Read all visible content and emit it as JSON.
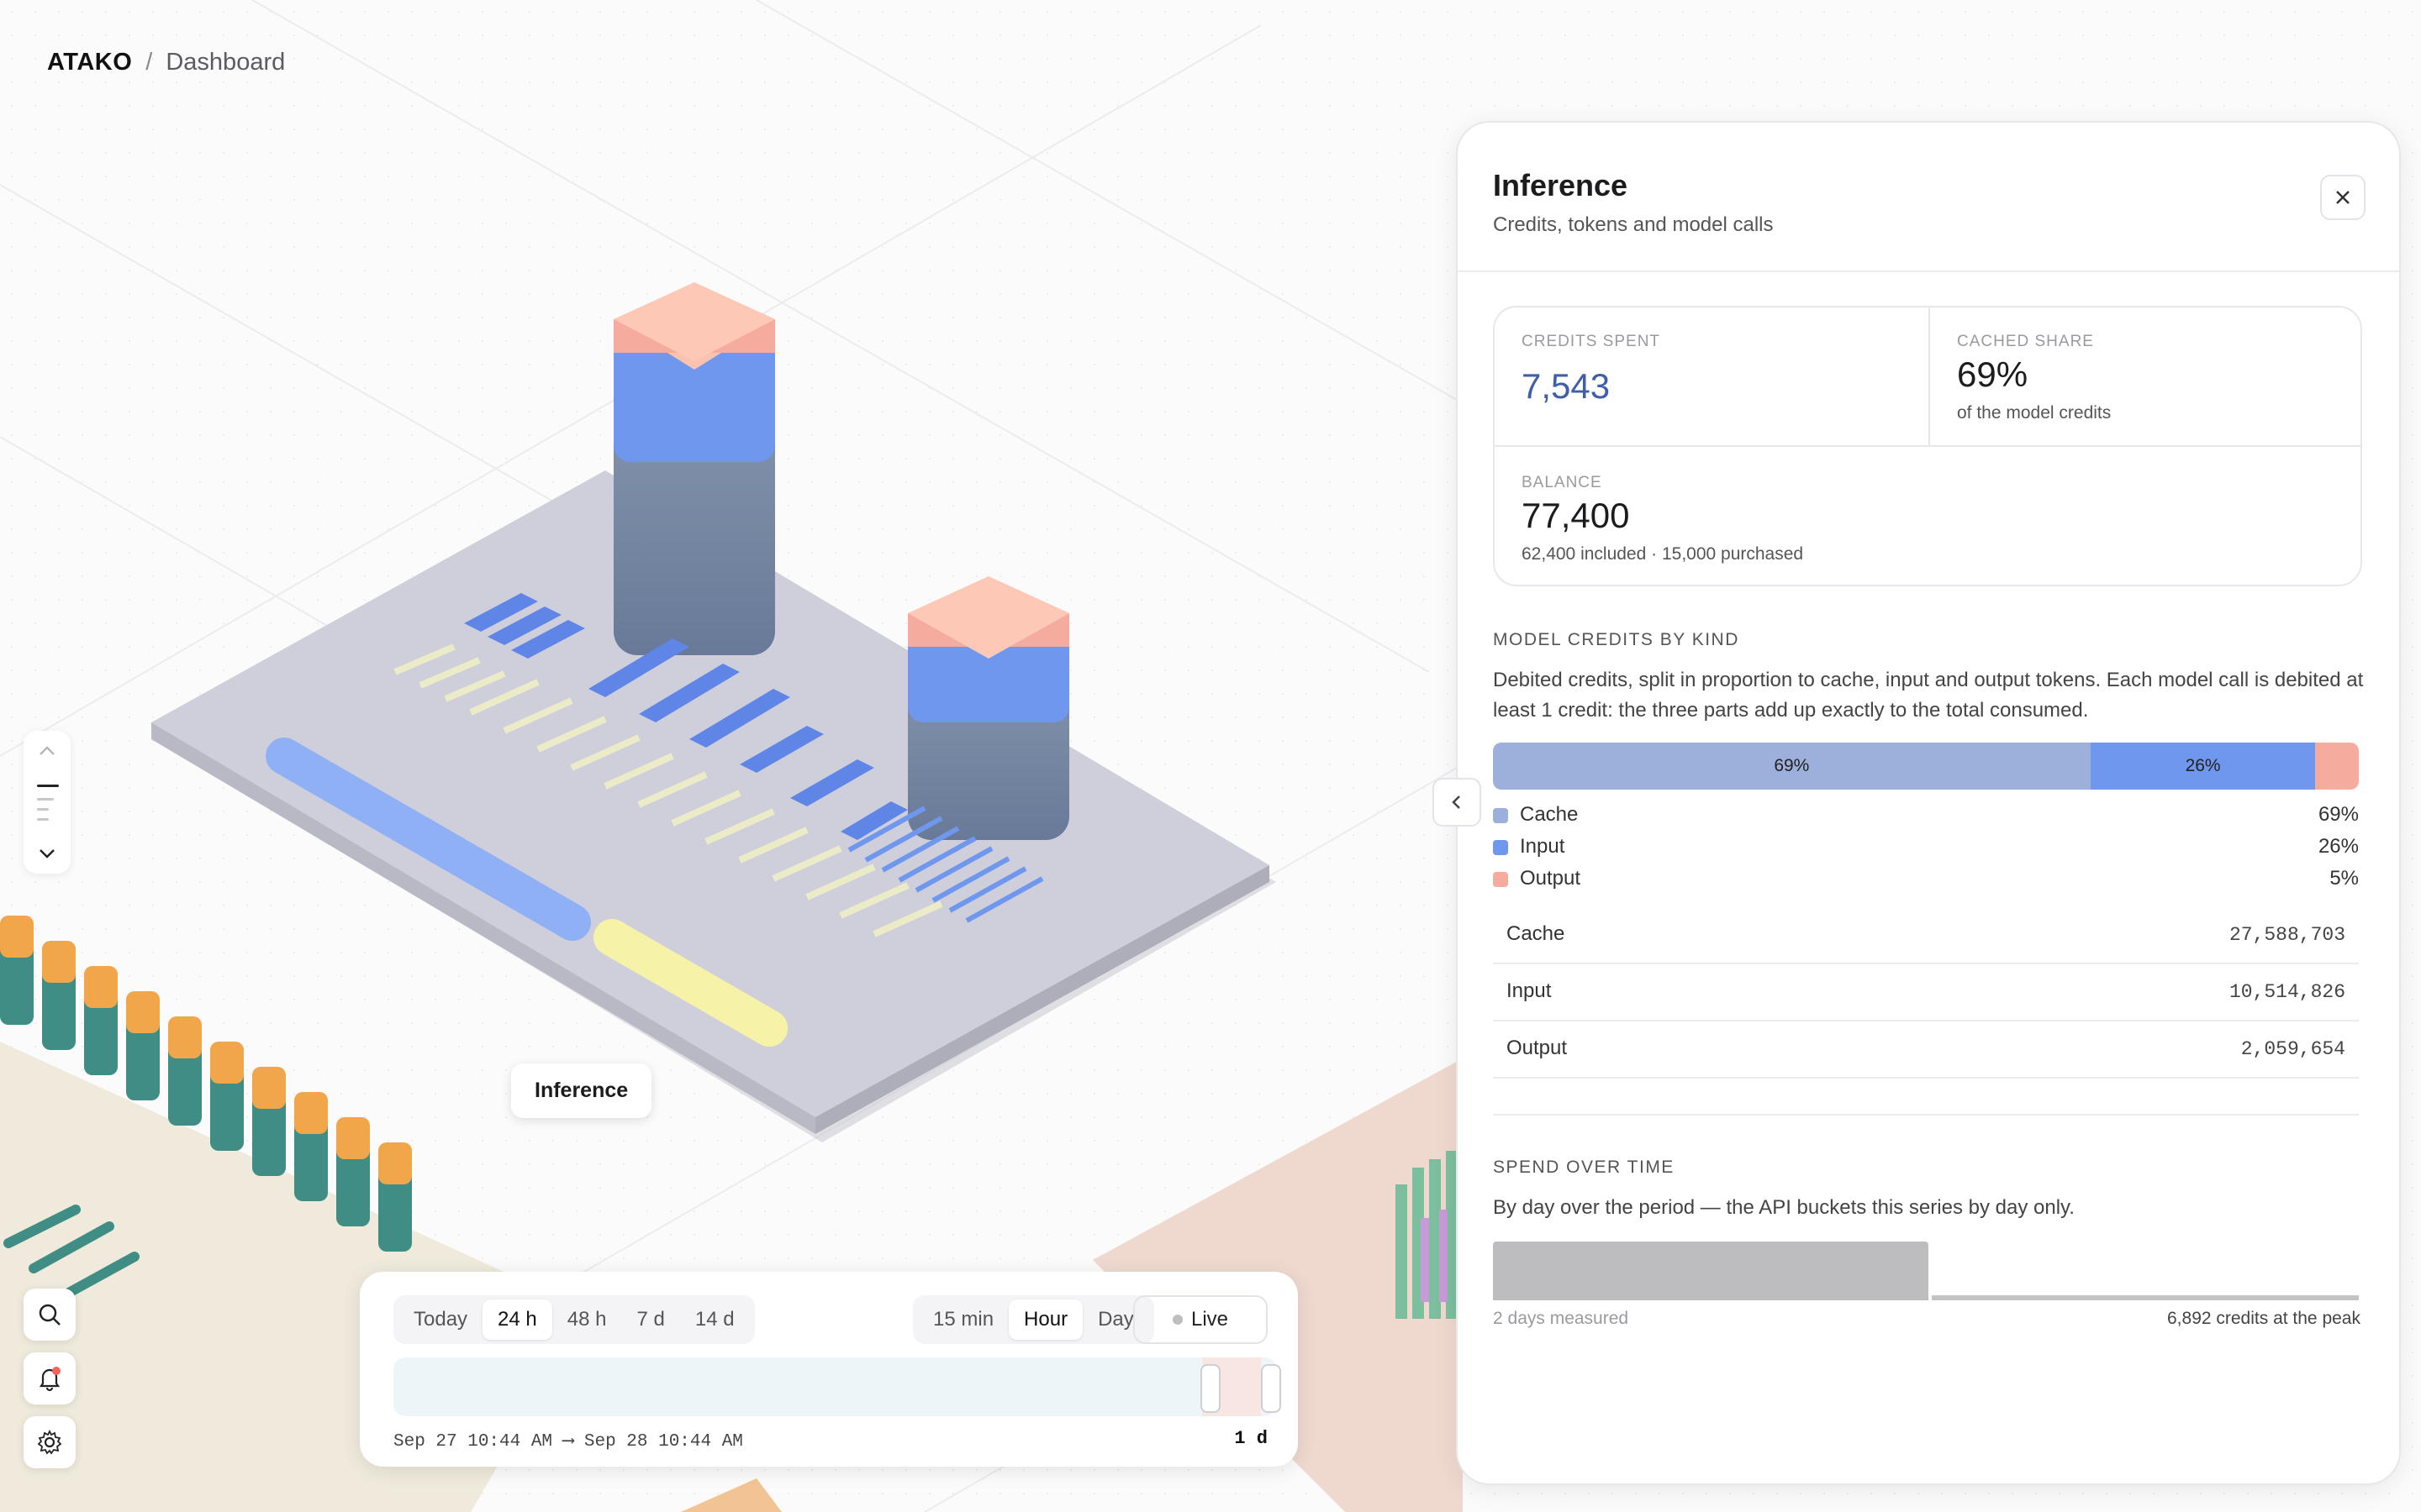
{
  "breadcrumb": {
    "brand": "ATAKO",
    "separator": "/",
    "page": "Dashboard"
  },
  "scene": {
    "selected_label": "Inference"
  },
  "timeline": {
    "ranges": [
      "Today",
      "24 h",
      "48 h",
      "7 d",
      "14 d"
    ],
    "active_range": "24 h",
    "granularity": [
      "15 min",
      "Hour",
      "Day"
    ],
    "active_granularity": "Hour",
    "live_label": "Live",
    "range_text": "Sep 27 10:44 AM ⟶ Sep 28 10:44 AM",
    "span": "1 d"
  },
  "panel": {
    "title": "Inference",
    "subtitle": "Credits, tokens and model calls",
    "stats": {
      "credits_spent": {
        "label": "CREDITS SPENT",
        "value": "7,543"
      },
      "cached_share": {
        "label": "CACHED SHARE",
        "value": "69%",
        "note": "of the model credits"
      },
      "balance": {
        "label": "BALANCE",
        "value": "77,400",
        "note": "62,400 included · 15,000 purchased"
      }
    },
    "kind": {
      "heading": "MODEL CREDITS BY KIND",
      "description": "Debited credits, split in proportion to cache, input and output tokens. Each model call is debited at least 1 credit: the three parts add up exactly to the total consumed.",
      "bar": [
        {
          "name": "Cache",
          "share": 0.69,
          "label": "69%",
          "color": "#9db0dc"
        },
        {
          "name": "Input",
          "share": 0.26,
          "label": "26%",
          "color": "#6f97ee"
        },
        {
          "name": "Output",
          "share": 0.05,
          "label": "",
          "color": "#f6ab9f"
        }
      ],
      "legend": [
        {
          "name": "Cache",
          "pct": "69%",
          "color": "#9db0dc"
        },
        {
          "name": "Input",
          "pct": "26%",
          "color": "#6f97ee"
        },
        {
          "name": "Output",
          "pct": "5%",
          "color": "#f6ab9f"
        }
      ],
      "table": [
        {
          "name": "Cache",
          "value": "27,588,703"
        },
        {
          "name": "Input",
          "value": "10,514,826"
        },
        {
          "name": "Output",
          "value": "2,059,654"
        }
      ]
    },
    "spend": {
      "heading": "SPEND OVER TIME",
      "description": "By day over the period — the API buckets this series by day only.",
      "left_note": "2 days measured",
      "right_note": "6,892 credits at the peak"
    }
  },
  "colors": {
    "accent_blue": "#3f5fa8",
    "live_dot": "#bdbdc2"
  }
}
